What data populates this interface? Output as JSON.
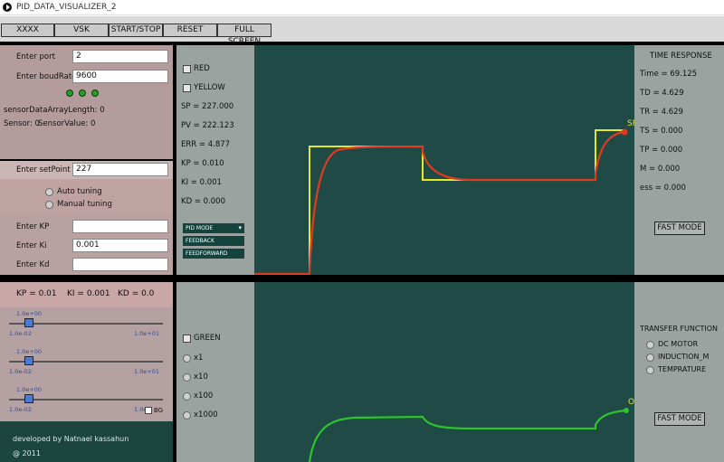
{
  "window": {
    "title": "PID_DATA_VISUALIZER_2"
  },
  "menu": [
    "XXXX",
    "VSK",
    "START/STOP",
    "RESET",
    "FULL SCREEN"
  ],
  "connection": {
    "port_label": "Enter port",
    "port_value": "2",
    "baud_label": "Enter boudRate",
    "baud_value": "9600",
    "array_length": "sensorDataArrayLength: 0",
    "sensor": "Sensor: 0",
    "sensor_value": "SensorValue: 0"
  },
  "setpoint": {
    "label": "Enter setPoint",
    "value": "227"
  },
  "tuning": {
    "auto": "Auto tuning",
    "manual": "Manual tuning"
  },
  "gains": {
    "kp_label": "Enter KP",
    "kp_value": "",
    "ki_label": "Enter Ki",
    "ki_value": "0.001",
    "kd_label": "Enter Kd",
    "kd_value": ""
  },
  "gain_display": {
    "kp": "KP = 0.01",
    "ki": "KI = 0.001",
    "kd": "KD = 0.0"
  },
  "sliders": [
    {
      "value_label": "1.0e+00",
      "min": "1.0e-02",
      "max": "1.0e+01",
      "position": 0.13
    },
    {
      "value_label": "1.0e+00",
      "min": "1.0e-02",
      "max": "1.0e+01",
      "position": 0.13
    },
    {
      "value_label": "1.0e+00",
      "min": "1.0e-02",
      "max": "1.0e",
      "position": 0.13
    }
  ],
  "bg_label": "BG",
  "footer": {
    "credit": "developed by Natnael kassahun",
    "year": "@ 2011"
  },
  "upper_side": {
    "red": "RED",
    "yellow": "YELLOW",
    "sp": "SP =   227.000",
    "pv": "PV =   222.123",
    "err": "ERR = 4.877",
    "kp": "KP  =  0.010",
    "ki": "KI   =  0.001",
    "kd": "KD  =  0.000",
    "mode_options": [
      "PID MODE",
      "FEEDBACK",
      "FEEDFORWARD"
    ]
  },
  "time_response": {
    "title": "TIME RESPONSE",
    "time": "Time = 69.125",
    "td": "TD  =   4.629",
    "tr": "TR  =   4.629",
    "ts": "TS  =   0.000",
    "tp": "TP  =   0.000",
    "m": "M    =   0.000",
    "ess": "ess =   0.000",
    "fast_mode": "FAST MODE"
  },
  "plot_labels": {
    "sp": "SP",
    "op": "OP"
  },
  "lower_side": {
    "green": "GREEN",
    "x1": "x1",
    "x10": "x10",
    "x100": "x100",
    "x1000": "x1000"
  },
  "transfer_function": {
    "title": "TRANSFER FUNCTION",
    "options": [
      "DC MOTOR",
      "INDUCTION_M",
      "TEMPRATURE"
    ],
    "fast_mode": "FAST MODE"
  },
  "colors": {
    "plot_bg": "#1f4a45",
    "setpoint_line": "#e6e62a",
    "output_line": "#e03a20",
    "lower_line": "#2ec42e"
  }
}
